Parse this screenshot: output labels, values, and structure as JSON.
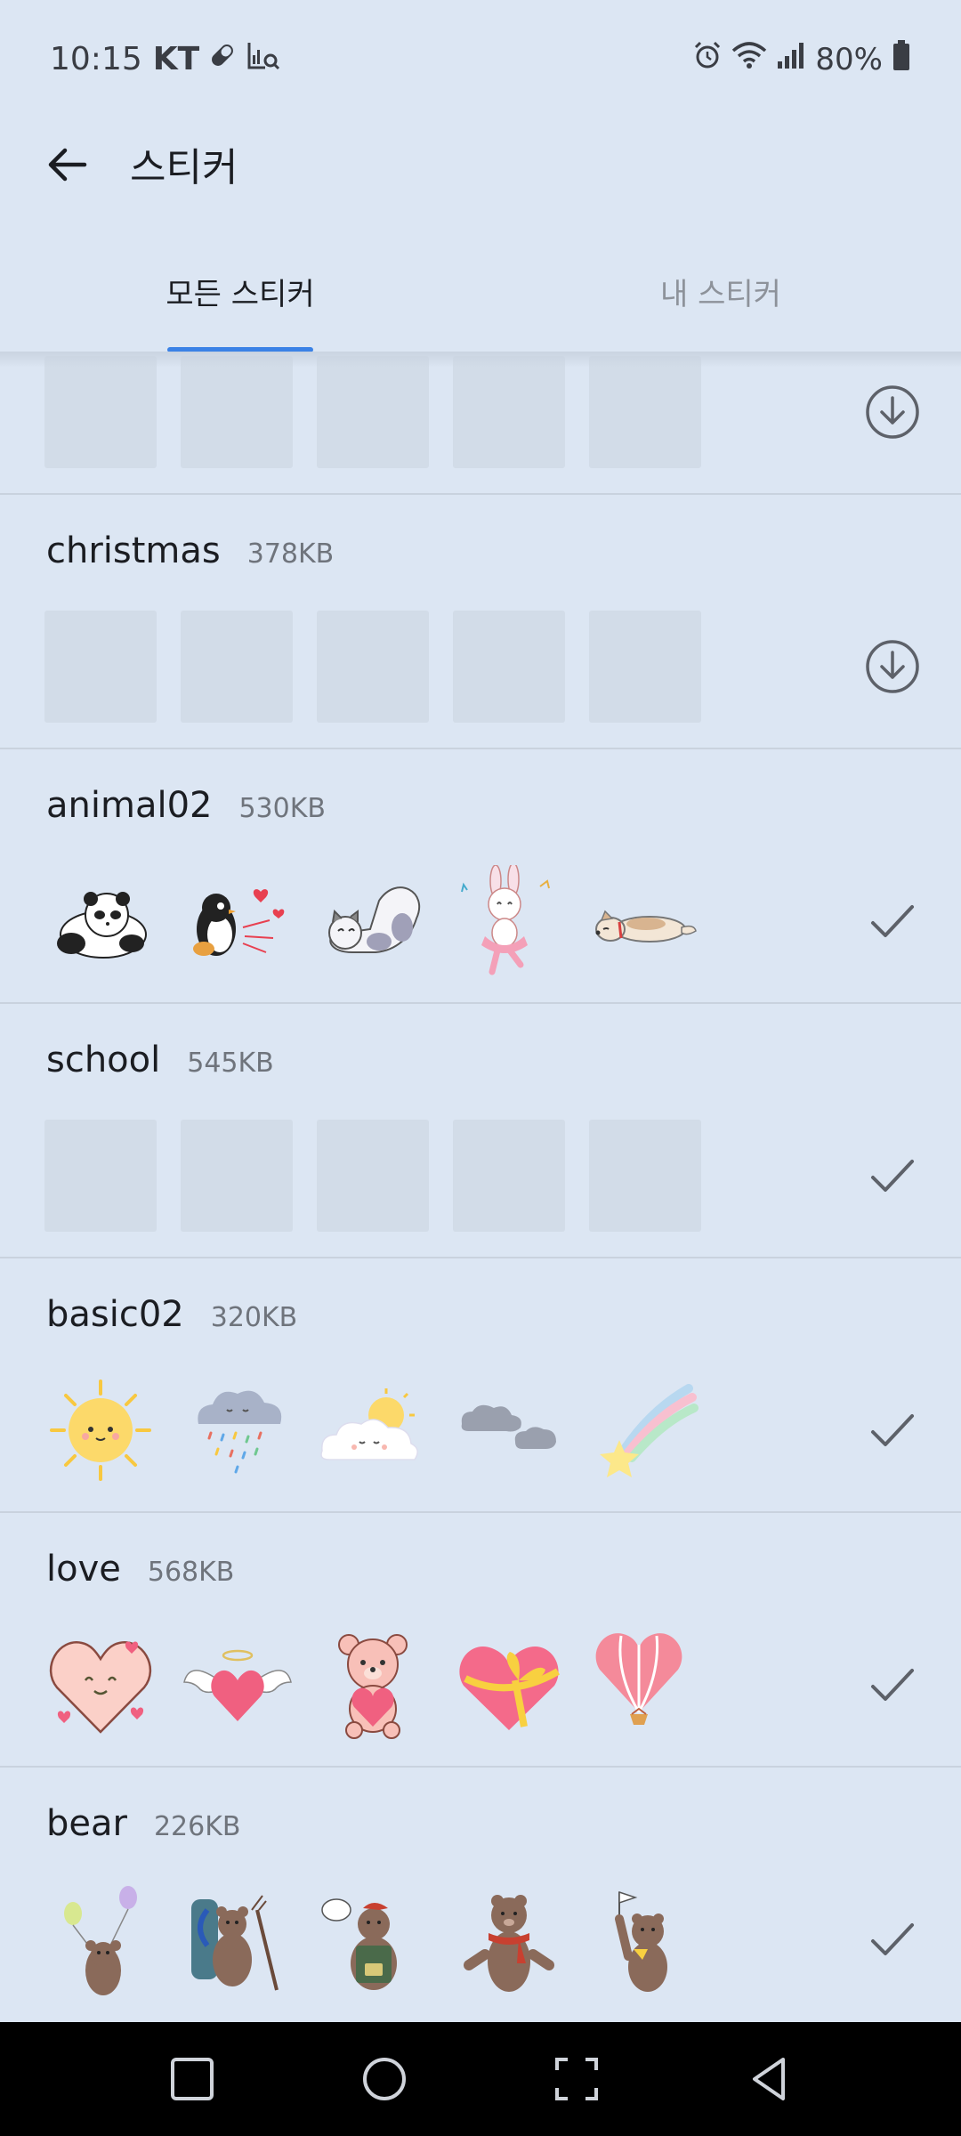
{
  "status_bar": {
    "time": "10:15",
    "carrier": "KT",
    "battery": "80%",
    "icons": [
      "pill-icon",
      "chart-search-icon",
      "alarm-icon",
      "wifi-icon",
      "signal-icon",
      "battery-icon"
    ]
  },
  "header": {
    "title": "스티커",
    "back_icon": "arrow-left-icon"
  },
  "tabs": {
    "all": "모든 스티커",
    "mine": "내 스티커",
    "active": "all"
  },
  "sections": [
    {
      "name": "",
      "size": "",
      "status": "download",
      "thumbs": [
        "",
        "",
        "",
        "",
        ""
      ]
    },
    {
      "name": "christmas",
      "size": "378KB",
      "status": "download",
      "thumbs": [
        "",
        "",
        "",
        "",
        ""
      ]
    },
    {
      "name": "animal02",
      "size": "530KB",
      "status": "downloaded",
      "thumbs": [
        "panda-sticker",
        "penguin-hearts-sticker",
        "cat-stretch-sticker",
        "bunny-dance-sticker",
        "dog-lying-sticker"
      ]
    },
    {
      "name": "school",
      "size": "545KB",
      "status": "downloaded",
      "thumbs": [
        "",
        "",
        "",
        "",
        ""
      ]
    },
    {
      "name": "basic02",
      "size": "320KB",
      "status": "downloaded",
      "thumbs": [
        "sun-sticker",
        "rain-cloud-sticker",
        "sun-cloud-sticker",
        "dark-clouds-sticker",
        "shooting-star-sticker"
      ]
    },
    {
      "name": "love",
      "size": "568KB",
      "status": "downloaded",
      "thumbs": [
        "smiling-heart-sticker",
        "winged-heart-sticker",
        "bear-heart-sticker",
        "heart-gift-sticker",
        "heart-balloon-sticker"
      ]
    },
    {
      "name": "bear",
      "size": "226KB",
      "status": "downloaded",
      "thumbs": [
        "bear-balloons-sticker",
        "bear-hiker-sticker",
        "bear-painter-sticker",
        "bear-scarf-sticker",
        "bear-flag-sticker"
      ]
    }
  ],
  "nav": [
    "recents-button",
    "home-button",
    "screenshot-button",
    "back-button"
  ],
  "colors": {
    "background": "#dce6f3",
    "accent": "#3b82e6",
    "placeholder": "#d2dce8"
  }
}
